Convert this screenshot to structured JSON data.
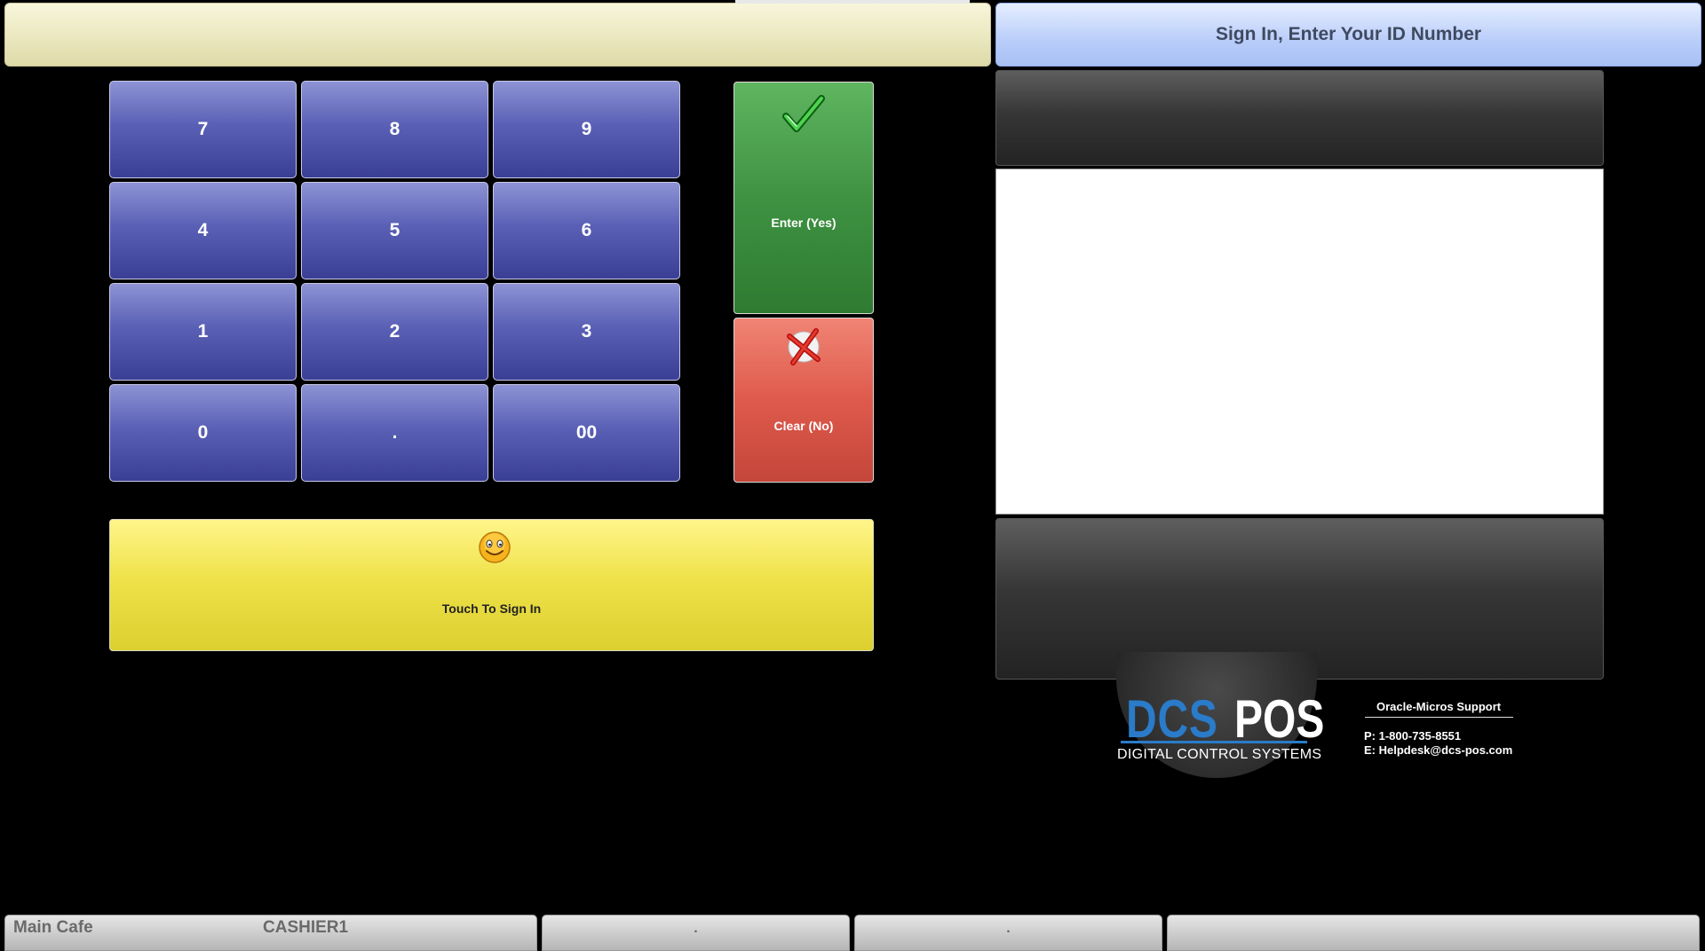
{
  "prompt": {
    "text": "Sign In, Enter Your ID Number"
  },
  "entry": {
    "value": ""
  },
  "keypad": {
    "keys": [
      "7",
      "8",
      "9",
      "4",
      "5",
      "6",
      "1",
      "2",
      "3",
      "0",
      ".",
      "00"
    ]
  },
  "actions": {
    "enter_label": "Enter (Yes)",
    "clear_label": "Clear (No)",
    "signin_label": "Touch To Sign In"
  },
  "icons": {
    "enter": "checkmark-icon",
    "clear": "x-mark-icon",
    "signin": "smiley-face-icon"
  },
  "logo": {
    "dcs": "DCS",
    "pos": "POS",
    "subtitle": "DIGITAL CONTROL SYSTEMS"
  },
  "support": {
    "title": "Oracle-Micros Support",
    "phone": "P: 1-800-735-8551",
    "email": "E: Helpdesk@dcs-pos.com"
  },
  "status": {
    "location": "Main Cafe",
    "user": "CASHIER1",
    "seg2": ".",
    "seg3": ".",
    "seg4": ""
  },
  "colors": {
    "keypad": "#4a50a6",
    "enter": "#3f9242",
    "clear": "#de5a4c",
    "signin": "#efe24a",
    "prompt": "#b9cdfa",
    "logo_blue": "#2a7bc9"
  }
}
